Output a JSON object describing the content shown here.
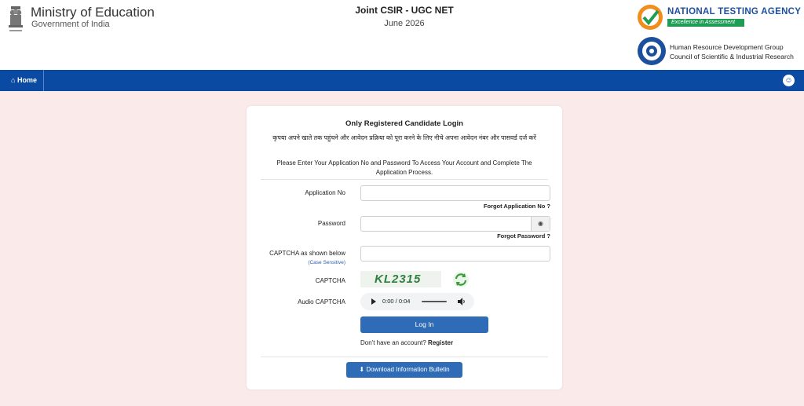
{
  "header": {
    "ministry": "Ministry of Education",
    "government": "Government of India",
    "exam_title": "Joint CSIR - UGC NET",
    "exam_session": "June 2026",
    "nta_name": "NATIONAL TESTING AGENCY",
    "nta_tagline": "Excellence in Assessment",
    "csir_line1": "Human Resource Development Group",
    "csir_line2": "Council of Scientific & Industrial Research"
  },
  "navbar": {
    "home_label": "Home"
  },
  "login": {
    "title": "Only Registered Candidate Login",
    "hindi_instruction": "कृपया अपने खाते तक पहुंचने और आवेदन प्रक्रिया को पूरा करने के लिए नीचे अपना आवेदन नंबर और पासवर्ड दर्ज करें",
    "english_instruction": "Please Enter Your Application No and Password To Access Your Account and Complete The Application Process.",
    "application_no_label": "Application No",
    "application_no_value": "",
    "forgot_application": "Forgot Application No ?",
    "password_label": "Password",
    "password_value": "",
    "forgot_password": "Forgot Password ?",
    "captcha_input_label": "CAPTCHA as shown below",
    "captcha_case_note": "(Case Sensitive)",
    "captcha_value": "",
    "captcha_label": "CAPTCHA",
    "captcha_text": "KL2315",
    "audio_captcha_label": "Audio CAPTCHA",
    "audio_time": "0:00 / 0:04",
    "login_button": "Log In",
    "no_account_text": "Don't have an account?",
    "register_link": "Register",
    "download_bulletin": "Download Information Bulletin"
  },
  "colors": {
    "navbar": "#0b4aa2",
    "button": "#2f6cb7",
    "page_background": "#fbeaea"
  }
}
